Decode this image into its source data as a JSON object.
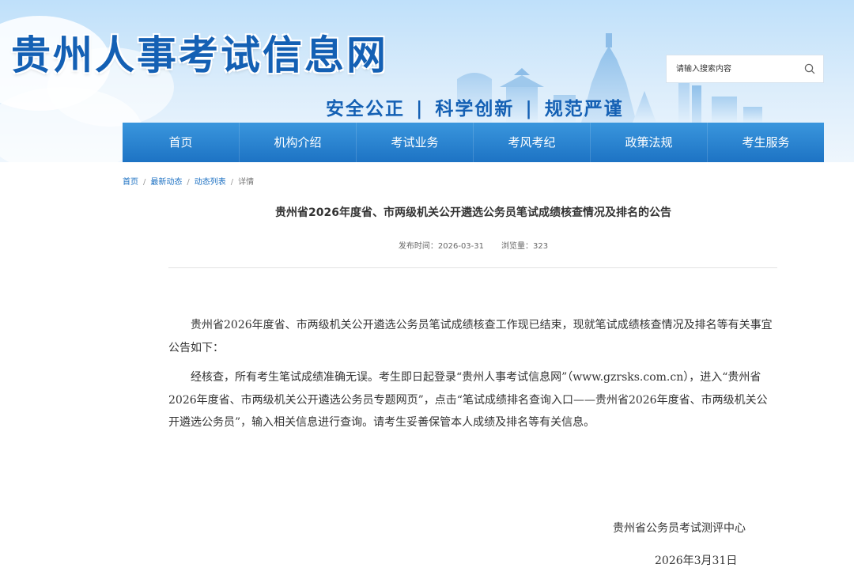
{
  "header": {
    "site_title": "贵州人事考试信息网",
    "slogan": [
      "安全公正",
      "科学创新",
      "规范严谨"
    ],
    "slogan_separator": "|"
  },
  "search": {
    "placeholder": "请输入搜索内容",
    "icon": "search-icon"
  },
  "nav": {
    "items": [
      {
        "label": "首页"
      },
      {
        "label": "机构介绍"
      },
      {
        "label": "考试业务"
      },
      {
        "label": "考风考纪"
      },
      {
        "label": "政策法规"
      },
      {
        "label": "考生服务"
      }
    ]
  },
  "breadcrumb": {
    "items": [
      "首页",
      "最新动态",
      "动态列表",
      "详情"
    ],
    "separator": "/"
  },
  "article": {
    "title": "贵州省2026年度省、市两级机关公开遴选公务员笔试成绩核查情况及排名的公告",
    "publish_label": "发布时间：",
    "publish_date": "2026-03-31",
    "views_label": "浏览量：",
    "views": "323",
    "paragraphs": [
      "贵州省2026年度省、市两级机关公开遴选公务员笔试成绩核查工作现已结束，现就笔试成绩核查情况及排名等有关事宜公告如下：",
      "经核查，所有考生笔试成绩准确无误。考生即日起登录“贵州人事考试信息网”（www.gzrsks.com.cn），进入“贵州省2026年度省、市两级机关公开遴选公务员专题网页”，点击“笔试成绩排名查询入口——贵州省2026年度省、市两级机关公开遴选公务员”，输入相关信息进行查询。请考生妥善保管本人成绩及排名等有关信息。"
    ],
    "signature_org": "贵州省公务员考试测评中心",
    "signature_date": "2026年3月31日"
  },
  "colors": {
    "brand_blue": "#1460b4",
    "nav_blue": "#1d73c4",
    "link_blue": "#1a6fc2"
  }
}
